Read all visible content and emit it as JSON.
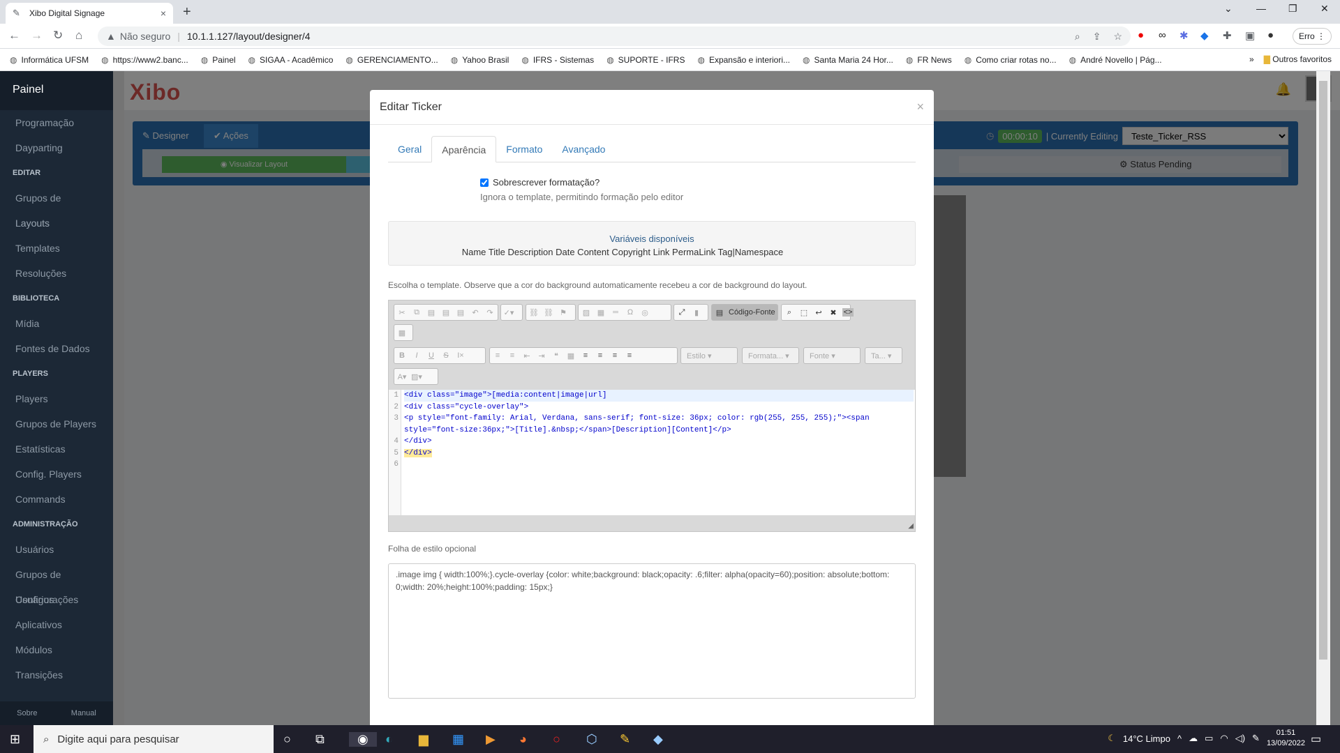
{
  "browser": {
    "tab_title": "Xibo Digital Signage",
    "url_warning": "Não seguro",
    "url": "10.1.1.127/layout/designer/4",
    "profile_btn": "Erro"
  },
  "bookmarks": [
    "Informática UFSM",
    "https://www2.banc...",
    "Painel",
    "SIGAA - Acadêmico",
    "GERENCIAMENTO...",
    "Yahoo Brasil",
    "IFRS - Sistemas",
    "SUPORTE - IFRS",
    "Expansão e interiori...",
    "Santa Maria 24 Hor...",
    "FR News",
    "Como criar rotas no...",
    "André Novello | Pág..."
  ],
  "bookmarks_more": "»",
  "bookmarks_other": "Outros favoritos",
  "sidebar": {
    "brand": "Painel",
    "items": [
      {
        "t": "i",
        "l": "Programação"
      },
      {
        "t": "i",
        "l": "Dayparting"
      },
      {
        "t": "s",
        "l": "EDITAR"
      },
      {
        "t": "i",
        "l": "Grupos de Layouts"
      },
      {
        "t": "i",
        "l": "Layouts"
      },
      {
        "t": "i",
        "l": "Templates"
      },
      {
        "t": "i",
        "l": "Resoluções"
      },
      {
        "t": "s",
        "l": "BIBLIOTECA"
      },
      {
        "t": "i",
        "l": "Mídia"
      },
      {
        "t": "i",
        "l": "Fontes de Dados"
      },
      {
        "t": "s",
        "l": "PLAYERS"
      },
      {
        "t": "i",
        "l": "Players"
      },
      {
        "t": "i",
        "l": "Grupos de Players"
      },
      {
        "t": "i",
        "l": "Estatísticas"
      },
      {
        "t": "i",
        "l": "Config. Players"
      },
      {
        "t": "i",
        "l": "Commands"
      },
      {
        "t": "s",
        "l": "ADMINISTRAÇÃO"
      },
      {
        "t": "i",
        "l": "Usuários"
      },
      {
        "t": "i",
        "l": "Grupos de Usuários"
      },
      {
        "t": "i",
        "l": "Configurações"
      },
      {
        "t": "i",
        "l": "Aplicativos"
      },
      {
        "t": "i",
        "l": "Módulos"
      },
      {
        "t": "i",
        "l": "Transições"
      }
    ],
    "foot_about": "Sobre",
    "foot_manual": "Manual"
  },
  "app": {
    "logo": "Xibo"
  },
  "designer": {
    "tab_designer": "Designer",
    "tab_actions": "Ações",
    "preview": "Visualizar Layout",
    "status": "Status Pending",
    "timer": "00:00:10",
    "editing_label": "| Currently Editing",
    "layout_name": "Teste_Ticker_RSS"
  },
  "modal": {
    "title": "Editar Ticker",
    "close": "×",
    "tabs": [
      "Geral",
      "Aparência",
      "Formato",
      "Avançado"
    ],
    "override_label": "Sobrescrever formatação?",
    "override_help": "Ignora o template, permitindo formação pelo editor",
    "vars_title": "Variáveis disponíveis",
    "vars_list": "Name Title Description Date Content Copyright Link PermaLink Tag|Namespace",
    "template_note": "Escolha o template. Observe que a cor do background automaticamente recebeu a cor de background do layout.",
    "source_btn": "Código-Fonte",
    "dd_style": "Estilo",
    "dd_format": "Formata...",
    "dd_font": "Fonte",
    "dd_size": "Ta...",
    "css_label": "Folha de estilo opcional",
    "css_value": ".image img { width:100%;}.cycle-overlay {color: white;background: black;opacity: .6;filter: alpha(opacity=60);position: absolute;bottom: 0;width: 20%;height:100%;padding: 15px;}"
  },
  "code": {
    "l1": "<div class=\"image\">[media:content|image|url]",
    "l2": "<div class=\"cycle-overlay\">",
    "l3a": "<p style=\"font-family: Arial, Verdana, sans-serif; font-size: 36px; color: rgb(255, 255, 255);\"><span",
    "l3b": "style=\"font-size:36px;\">[Title].&nbsp;</span>[Description][Content]</p>",
    "l4": "</div>",
    "l5": "</div>",
    "nums": [
      "1",
      "2",
      "3",
      "",
      "4",
      "5",
      "6"
    ]
  },
  "taskbar": {
    "search": "Digite aqui para pesquisar",
    "weather": "14°C  Limpo",
    "time": "01:51",
    "date": "13/09/2022"
  }
}
